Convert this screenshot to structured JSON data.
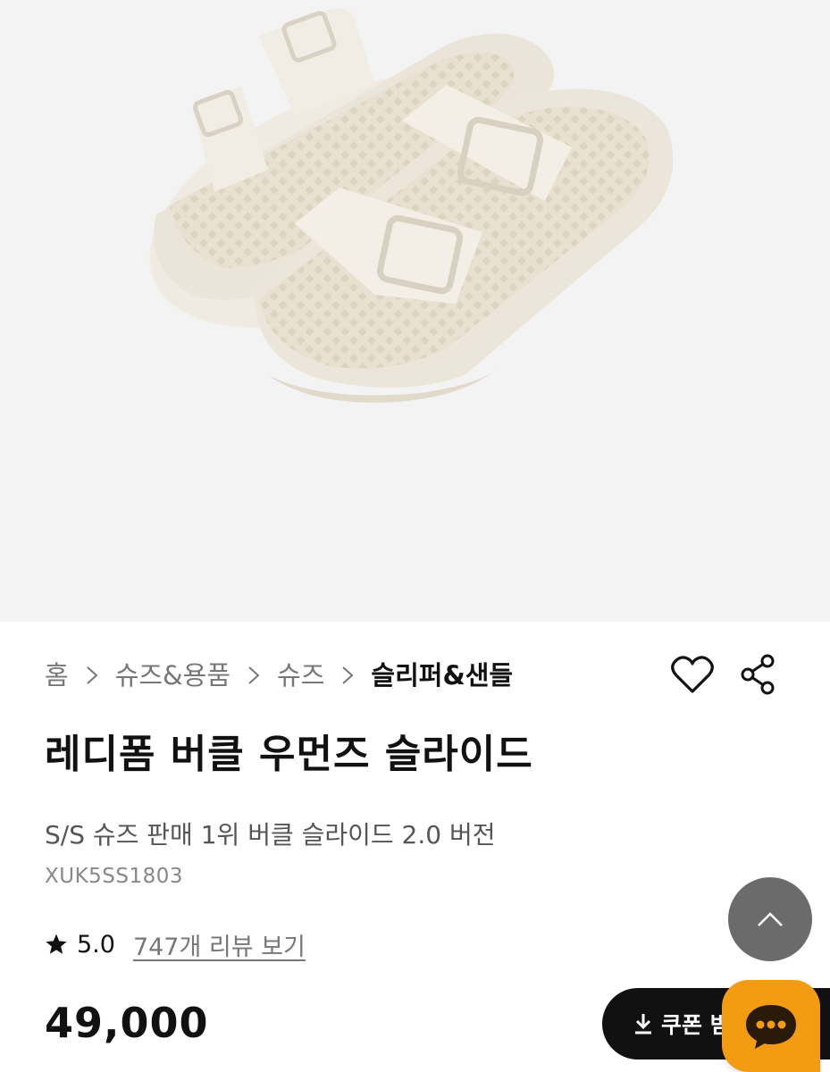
{
  "breadcrumb": {
    "items": [
      "홈",
      "슈즈&용품",
      "슈즈",
      "슬리퍼&샌들"
    ]
  },
  "icons": {
    "wishlist": "heart-outline-icon",
    "share": "share-icon",
    "rating": "star-icon",
    "scroll_top": "chevron-up-icon",
    "download": "download-icon",
    "chat": "chat-bubble-icon"
  },
  "product": {
    "title": "레디폼 버클 우먼즈 슬라이드",
    "subtitle": "S/S 슈즈 판매 1위 버클 슬라이드 2.0 버전",
    "sku": "XUK5SS1803",
    "rating": "5.0",
    "review_link": "747개 리뷰 보기",
    "price": "49,000"
  },
  "coupon_button": {
    "label": "쿠폰 받"
  },
  "colors": {
    "hero_bg": "#f3f3f3",
    "sandal": "#ece6da",
    "scroll_top_bg": "#6b6b6b",
    "coupon_bg": "#111111",
    "chat_bg": "#f39c12"
  }
}
